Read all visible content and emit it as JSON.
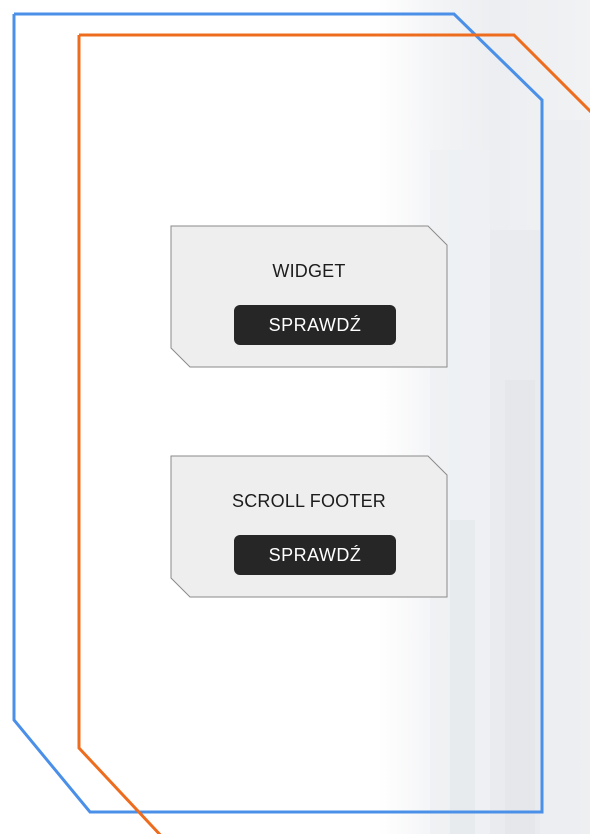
{
  "cards": [
    {
      "title": "WIDGET",
      "button_label": "SPRAWDŹ"
    },
    {
      "title": "SCROLL FOOTER",
      "button_label": "SPRAWDŹ"
    }
  ],
  "colors": {
    "frame_blue": "#4a8fe8",
    "frame_orange": "#ee6c1e",
    "card_fill": "#eeeeee",
    "card_border": "#8a8a8a",
    "button_bg": "#262626",
    "button_text": "#ffffff"
  }
}
